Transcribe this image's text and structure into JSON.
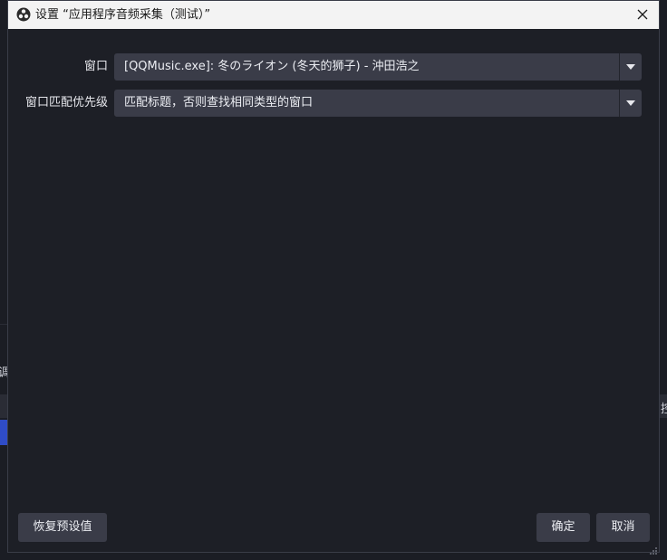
{
  "window": {
    "title": "设置 “应用程序音频采集（测试）”",
    "close_icon": "close-icon",
    "logo_icon": "obs-logo-icon"
  },
  "form": {
    "window_label": "窗口",
    "window_value": "[QQMusic.exe]: 冬のライオン (冬天的狮子) - 沖田浩之",
    "priority_label": "窗口匹配优先级",
    "priority_value": "匹配标题，否则查找相同类型的窗口"
  },
  "buttons": {
    "defaults": "恢复预设值",
    "ok": "确定",
    "cancel": "取消"
  },
  "background": {
    "left_char": "调",
    "right_char": "控"
  },
  "colors": {
    "accent": "#2f4cc7",
    "dialog_bg": "#1d1f26",
    "control_bg": "#3a3c48"
  }
}
